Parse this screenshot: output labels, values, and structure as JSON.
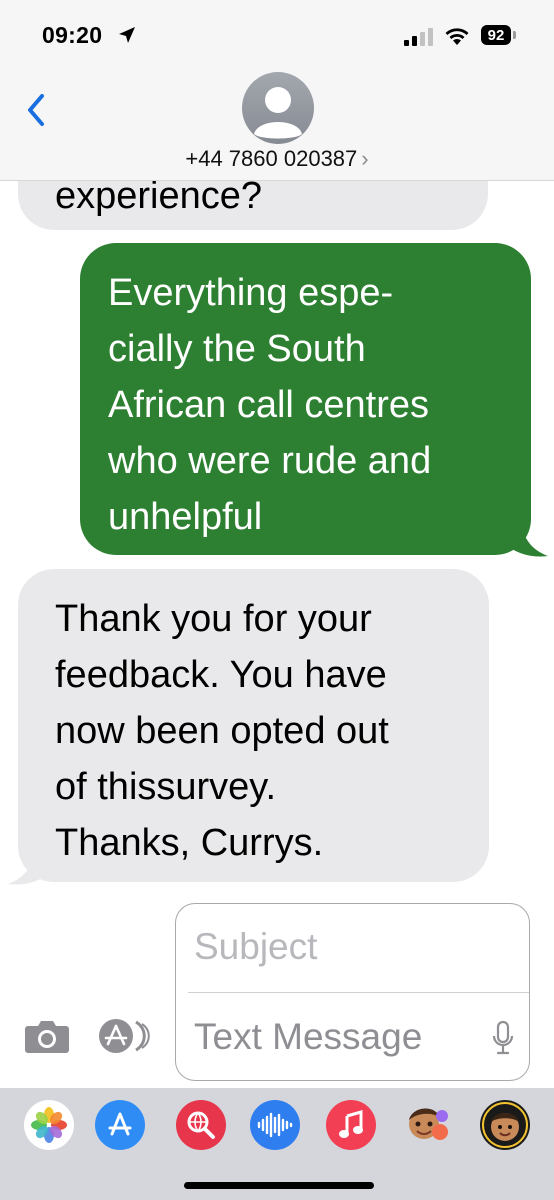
{
  "status_bar": {
    "time": "09:20",
    "battery": "92"
  },
  "header": {
    "contact": "+44 7860 020387",
    "chevron": "›"
  },
  "messages": [
    {
      "direction": "incoming",
      "lines": [
        "experience?"
      ]
    },
    {
      "direction": "outgoing",
      "lines": [
        "Everything espe-",
        "cially the South",
        "African call centres",
        "who were rude and",
        "unhelpful"
      ]
    },
    {
      "direction": "incoming",
      "lines": [
        "Thank you for your",
        "feedback. You have",
        "now been opted out",
        "of thissurvey.",
        "Thanks, Currys."
      ]
    }
  ],
  "compose": {
    "subject_placeholder": "Subject",
    "message_placeholder": "Text Message"
  },
  "colors": {
    "outgoing_bubble": "#2d8032",
    "incoming_bubble": "#e9e9eb",
    "accent": "#1a6fe0"
  },
  "app_drawer": [
    "photos-icon",
    "app-store-icon",
    "images-search-icon",
    "audio-message-icon",
    "music-icon",
    "memoji-icon",
    "memoji-stickers-icon"
  ]
}
